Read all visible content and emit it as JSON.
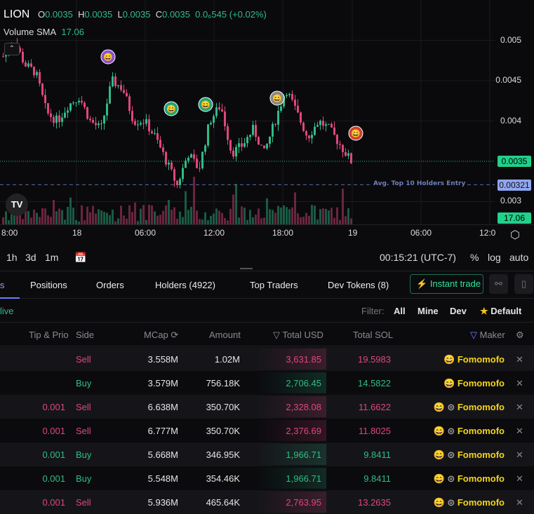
{
  "legend": {
    "symbol": "LION",
    "o_label": "O",
    "o": "0.0035",
    "h_label": "H",
    "h": "0.0035",
    "l_label": "L",
    "l": "0.0035",
    "c_label": "C",
    "c": "0.0035",
    "change": "0.0₆545 (+0.02%)",
    "volume_label": "Volume SMA",
    "volume": "17.06"
  },
  "price_axis": [
    "0.005",
    "0.0045",
    "0.004",
    "0.003"
  ],
  "tags": {
    "last": "0.0035",
    "avg": "0.00321",
    "vol": "17.06"
  },
  "avg_line_label": "Avg. Top 10 Holders Entry",
  "time_axis": [
    "8:00",
    "18",
    "06:00",
    "12:00",
    "18:00",
    "19",
    "06:00",
    "12:0"
  ],
  "price_path": [
    0.0048,
    0.005,
    0.0047,
    0.0046,
    0.0041,
    0.004,
    0.0042,
    0.0043,
    0.004,
    0.0039,
    0.0045,
    0.0044,
    0.004,
    0.004,
    0.0038,
    0.0035,
    0.0032,
    0.0036,
    0.0034,
    0.004,
    0.0042,
    0.0036,
    0.0037,
    0.0039,
    0.0036,
    0.004,
    0.0044,
    0.0041,
    0.0038,
    0.004,
    0.0039,
    0.0037,
    0.0035
  ],
  "toolbar": {
    "intervals": [
      "1h",
      "3d",
      "1m"
    ],
    "clock": "00:15:21 (UTC-7)",
    "percent": "%",
    "log": "log",
    "auto": "auto"
  },
  "tabs": [
    "s",
    "Positions",
    "Orders",
    "Holders (4922)",
    "Top Traders",
    "Dev Tokens (8)"
  ],
  "instant_trade": "Instant trade",
  "filter": {
    "live": "live",
    "label": "Filter:",
    "options": [
      "All",
      "Mine",
      "Dev"
    ],
    "default": "Default"
  },
  "columns": [
    "Tip & Prio",
    "Side",
    "MCap",
    "Amount",
    "Total USD",
    "Total SOL",
    "Maker"
  ],
  "rows": [
    {
      "tip": "",
      "side": "Sell",
      "mcap": "3.558M",
      "amount": "1.02M",
      "usd": "3,631.85",
      "sol": "19.5983",
      "maker": "Fomomofo"
    },
    {
      "tip": "",
      "side": "Buy",
      "mcap": "3.579M",
      "amount": "756.18K",
      "usd": "2,706.45",
      "sol": "14.5822",
      "maker": "Fomomofo"
    },
    {
      "tip": "0.001",
      "side": "Sell",
      "mcap": "6.638M",
      "amount": "350.70K",
      "usd": "2,328.08",
      "sol": "11.6622",
      "maker": "Fomomofo"
    },
    {
      "tip": "0.001",
      "side": "Sell",
      "mcap": "6.777M",
      "amount": "350.70K",
      "usd": "2,376.69",
      "sol": "11.8025",
      "maker": "Fomomofo"
    },
    {
      "tip": "0.001",
      "side": "Buy",
      "mcap": "5.668M",
      "amount": "346.95K",
      "usd": "1,966.71",
      "sol": "9.8411",
      "maker": "Fomomofo"
    },
    {
      "tip": "0.001",
      "side": "Buy",
      "mcap": "5.548M",
      "amount": "354.46K",
      "usd": "1,966.71",
      "sol": "9.8411",
      "maker": "Fomomofo"
    },
    {
      "tip": "0.001",
      "side": "Sell",
      "mcap": "5.936M",
      "amount": "465.64K",
      "usd": "2,763.95",
      "sol": "13.2635",
      "maker": "Fomomofo"
    }
  ]
}
